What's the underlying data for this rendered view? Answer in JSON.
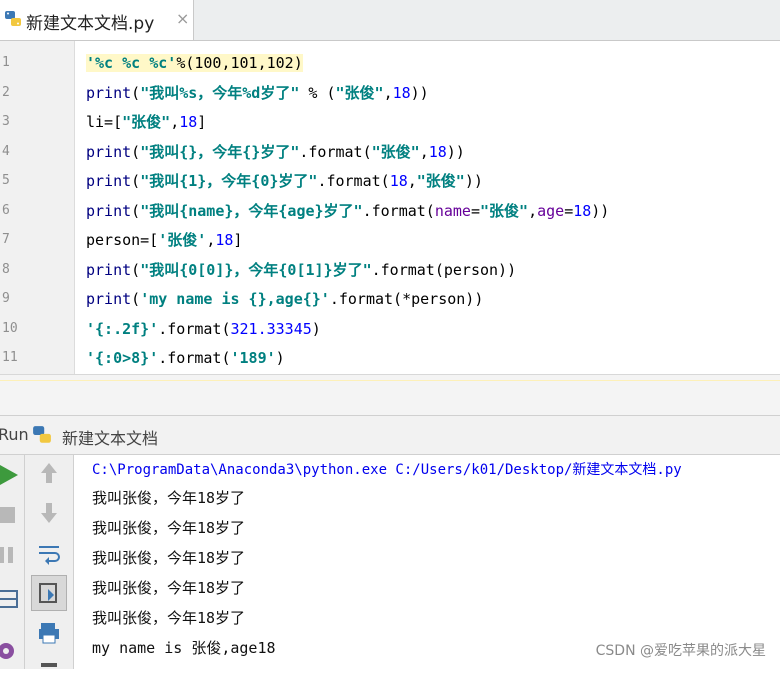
{
  "tab": {
    "filename": "新建文本文档.py",
    "close": "×"
  },
  "editor": {
    "line_numbers": [
      "1",
      "2",
      "3",
      "4",
      "5",
      "6",
      "7",
      "8",
      "9",
      "10",
      "11"
    ],
    "lines": [
      [
        [
          "s",
          "'%c %c %c'"
        ],
        [
          "p",
          "%(100,101,102)"
        ]
      ],
      [
        [
          "kw",
          "print"
        ],
        [
          "p",
          "("
        ],
        [
          "s",
          "\"我叫%s，今年%d岁了\""
        ],
        [
          "p",
          " % ("
        ],
        [
          "s",
          "\"张俊\""
        ],
        [
          "p",
          ","
        ],
        [
          "n",
          "18"
        ],
        [
          "p",
          "))"
        ]
      ],
      [
        [
          "p",
          "li=["
        ],
        [
          "s",
          "\"张俊\""
        ],
        [
          "p",
          ","
        ],
        [
          "n",
          "18"
        ],
        [
          "p",
          "]"
        ]
      ],
      [
        [
          "kw",
          "print"
        ],
        [
          "p",
          "("
        ],
        [
          "s",
          "\"我叫{}，今年{}岁了\""
        ],
        [
          "p",
          ".format("
        ],
        [
          "s",
          "\"张俊\""
        ],
        [
          "p",
          ","
        ],
        [
          "n",
          "18"
        ],
        [
          "p",
          "))"
        ]
      ],
      [
        [
          "kw",
          "print"
        ],
        [
          "p",
          "("
        ],
        [
          "s",
          "\"我叫{1}，今年{0}岁了\""
        ],
        [
          "p",
          ".format("
        ],
        [
          "n",
          "18"
        ],
        [
          "p",
          ","
        ],
        [
          "s",
          "\"张俊\""
        ],
        [
          "p",
          "))"
        ]
      ],
      [
        [
          "kw",
          "print"
        ],
        [
          "p",
          "("
        ],
        [
          "s",
          "\"我叫{name}，今年{age}岁了\""
        ],
        [
          "p",
          ".format("
        ],
        [
          "kwarg",
          "name"
        ],
        [
          "p",
          "="
        ],
        [
          "s",
          "\"张俊\""
        ],
        [
          "p",
          ","
        ],
        [
          "kwarg",
          "age"
        ],
        [
          "p",
          "="
        ],
        [
          "n",
          "18"
        ],
        [
          "p",
          "))"
        ]
      ],
      [
        [
          "p",
          "person=["
        ],
        [
          "s",
          "'张俊'"
        ],
        [
          "p",
          ","
        ],
        [
          "n",
          "18"
        ],
        [
          "p",
          "]"
        ]
      ],
      [
        [
          "kw",
          "print"
        ],
        [
          "p",
          "("
        ],
        [
          "s",
          "\"我叫{0[0]}，今年{0[1]}岁了\""
        ],
        [
          "p",
          ".format(person))"
        ]
      ],
      [
        [
          "kw",
          "print"
        ],
        [
          "p",
          "("
        ],
        [
          "s",
          "'my name is {},age{}'"
        ],
        [
          "p",
          ".format(*person))"
        ]
      ],
      [
        [
          "s",
          "'{:.2f}'"
        ],
        [
          "p",
          ".format("
        ],
        [
          "n",
          "321.33345"
        ],
        [
          "p",
          ")"
        ]
      ],
      [
        [
          "s",
          "'{:0>8}'"
        ],
        [
          "p",
          ".format("
        ],
        [
          "s",
          "'189'"
        ],
        [
          "p",
          ")"
        ]
      ]
    ]
  },
  "run": {
    "label": "Run",
    "config_name": "新建文本文档",
    "command": "C:\\ProgramData\\Anaconda3\\python.exe C:/Users/k01/Desktop/新建文本文档.py",
    "output": [
      "我叫张俊，今年18岁了",
      "我叫张俊，今年18岁了",
      "我叫张俊，今年18岁了",
      "我叫张俊，今年18岁了",
      "我叫张俊，今年18岁了",
      "my name is 张俊,age18"
    ]
  },
  "watermark": "CSDN @爱吃苹果的派大星",
  "colors": {
    "keyword": "#000080",
    "string": "#008080",
    "number": "#0000ff",
    "command": "#0000ee",
    "run_green": "#3d9a3d"
  }
}
